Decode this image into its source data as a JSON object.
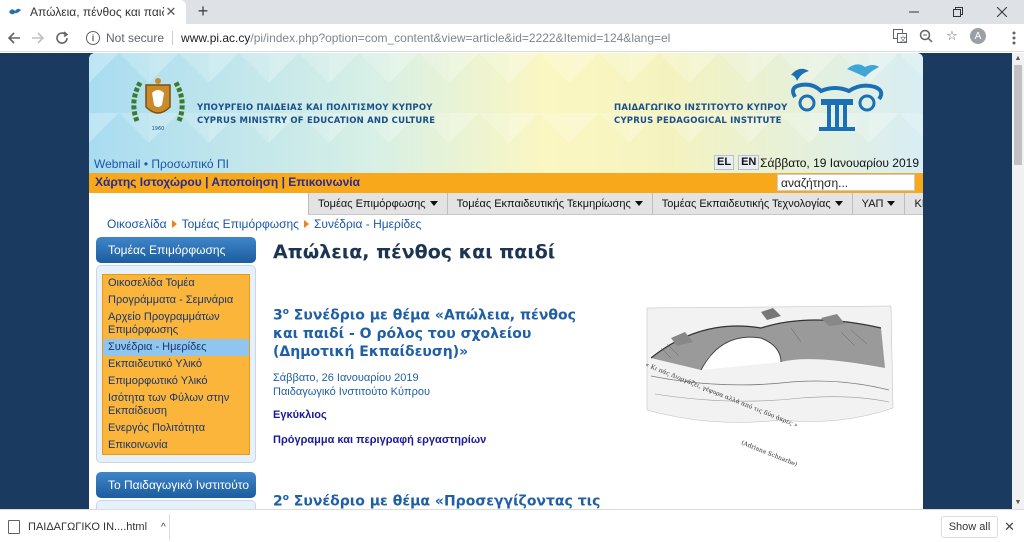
{
  "browser": {
    "tab_title": "Απώλεια, πένθος και παιδί",
    "tab_close": "✕",
    "new_tab": "+",
    "not_secure": "Not secure",
    "url_host": "www.pi.ac.cy",
    "url_path": "/pi/index.php?option=com_content&view=article&id=2222&Itemid=124&lang=el",
    "avatar_letter": "A"
  },
  "header": {
    "ministry_line1": "ΥΠΟΥΡΓΕΙΟ ΠΑΙΔΕΙΑΣ ΚΑΙ ΠΟΛΙΤΙΣΜΟΥ ΚΥΠΡΟΥ",
    "ministry_line2": "CYPRUS MINISTRY OF EDUCATION AND CULTURE",
    "pi_line1": "ΠΑΙΔΑΓΩΓΙΚΟ ΙΝΣΤΙΤΟΥΤΟ ΚΥΠΡΟΥ",
    "pi_line2": "CYPRUS PEDAGOGICAL INSTITUTE",
    "webmail": "Webmail",
    "bullet": "•",
    "personal": "Προσωπικό ΠΙ",
    "lang_el": "EL",
    "lang_en": "EN",
    "date": "Σάββατο, 19 Ιανουαρίου 2019"
  },
  "orangebar": {
    "sitemap": "Χάρτης Ιστοχώρου",
    "sep": "|",
    "disclaimer": "Αποποίηση",
    "contact": "Επικοινωνία",
    "search_value": "αναζήτηση..."
  },
  "menu": {
    "items": [
      "Τομέας Επιμόρφωσης",
      "Τομέας Εκπαιδευτικής Τεκμηρίωσης",
      "Τομέας Εκπαιδευτικής Τεχνολογίας",
      "ΥΑΠ",
      "ΚΕΕΑ"
    ]
  },
  "breadcrumb": {
    "home": "Οικοσελίδα",
    "section": "Τομέας Επιμόρφωσης",
    "current": "Συνέδρια - Ημερίδες"
  },
  "sidebar": {
    "heading": "Τομέας Επιμόρφωσης",
    "items": [
      "Οικοσελίδα Τομέα",
      "Προγράμματα - Σεμινάρια",
      "Αρχείο Προγραμμάτων Επιμόρφωσης",
      "Συνέδρια - Ημερίδες",
      "Εκπαιδευτικό Υλικό",
      "Επιμορφωτικό Υλικό",
      "Ισότητα των Φύλων στην Εκπαίδευση",
      "Ενεργός Πολιτότητα",
      "Επικοινωνία"
    ],
    "active_index": 3,
    "heading2": "Το Παιδαγωγικό Ινστιτούτο"
  },
  "article": {
    "title": "Απώλεια, πένθος και παιδί",
    "section1_num": "3",
    "section1_sup": "ο",
    "section1_text": " Συνέδριο με θέμα «Απώλεια, πένθος και παιδί - Ο ρόλος του σχολείου (Δημοτική Εκπαίδευση)»",
    "date": "Σάββατο, 26 Ιανουαρίου 2019",
    "venue": "Παιδαγωγικό Ινστιτούτο Κύπρου",
    "link1": "Εγκύκλιος",
    "link2": "Πρόγραμμα και περιγραφή εργαστηρίων",
    "section2_num": "2",
    "section2_sup": "ο",
    "section2_text": " Συνέδριο με θέμα «Προσεγγίζοντας τις"
  },
  "download": {
    "filename": "ΠΑΙΔΑΓΩΓΙΚΟ ΙΝ....html",
    "chevron": "^",
    "show_all": "Show all",
    "close": "✕"
  },
  "colors": {
    "accent_orange": "#f7a81b",
    "nav_blue": "#1b5d9e",
    "page_bg": "#1b3a5f"
  }
}
